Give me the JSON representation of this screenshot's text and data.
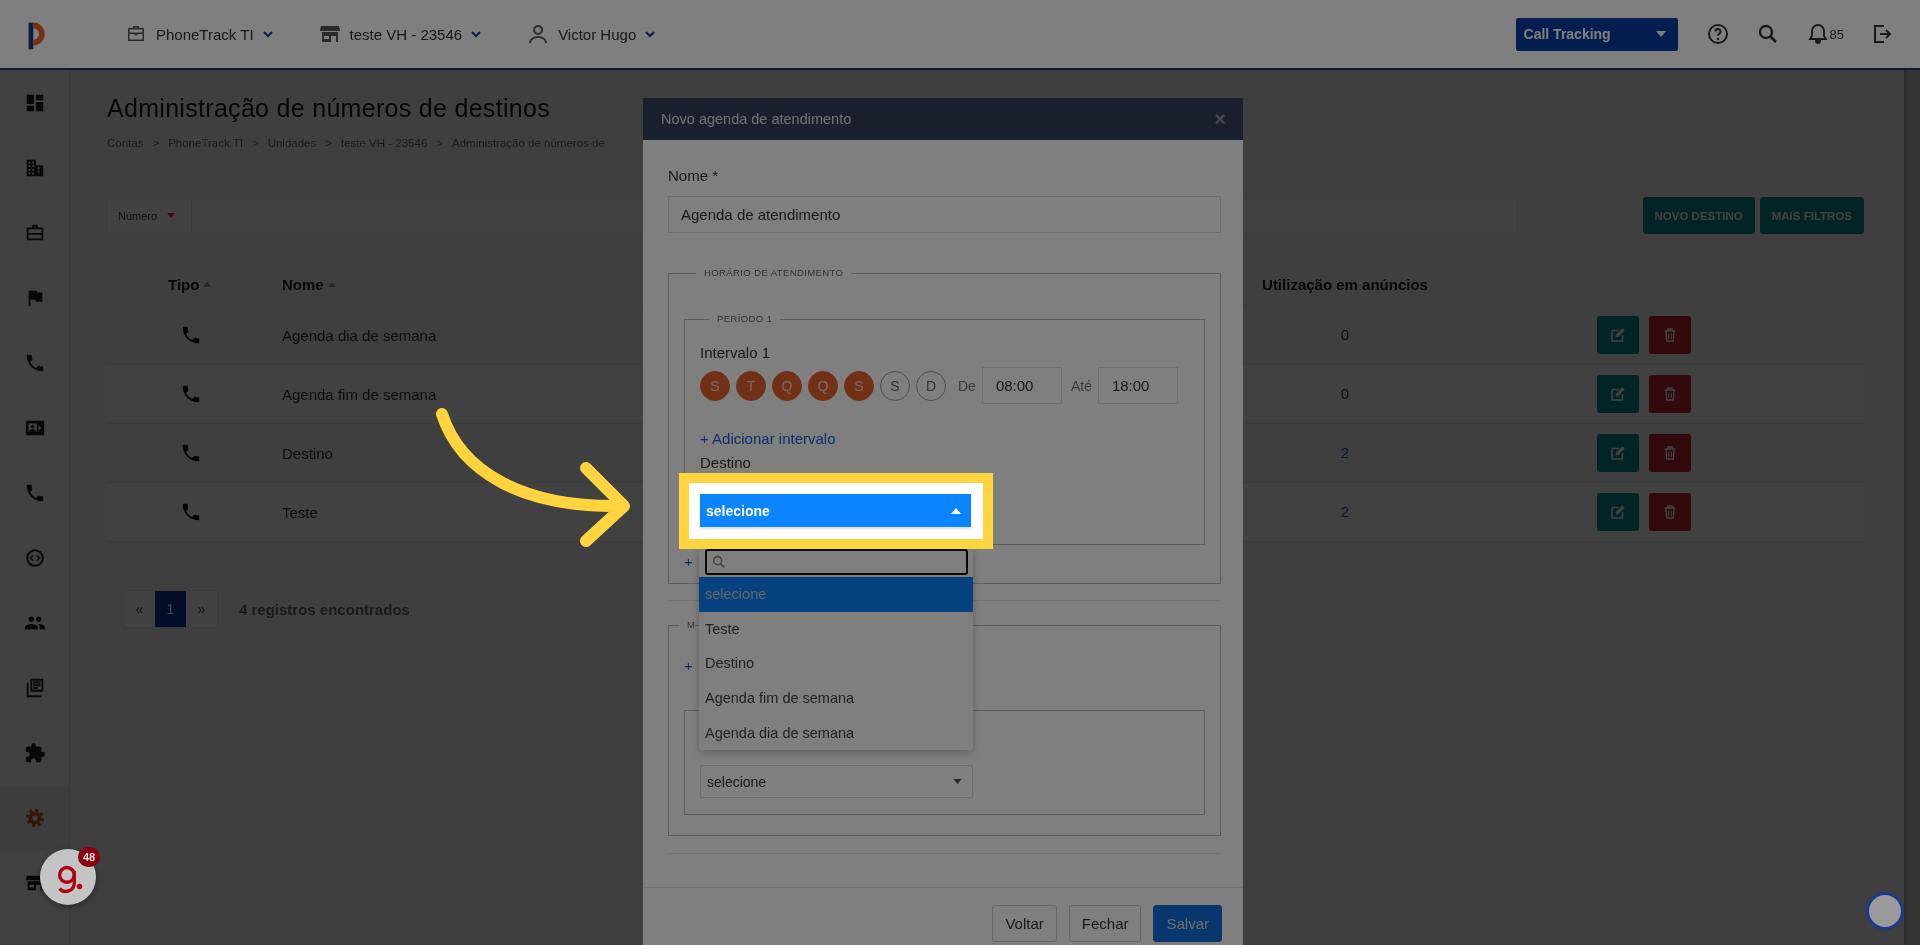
{
  "topbar": {
    "account": "PhoneTrack TI",
    "unit": "teste VH - 23546",
    "user": "Victor Hugo",
    "product": "Call Tracking",
    "notifications": "85"
  },
  "sidebar": {
    "items": [
      {
        "kind": "dashboard",
        "selected": false
      },
      {
        "kind": "building",
        "selected": false
      },
      {
        "kind": "briefcase",
        "selected": false
      },
      {
        "kind": "flag",
        "selected": false
      },
      {
        "kind": "phone",
        "selected": false
      },
      {
        "kind": "card",
        "selected": false
      },
      {
        "kind": "phone",
        "selected": false
      },
      {
        "kind": "code",
        "selected": false
      },
      {
        "kind": "people",
        "selected": false
      },
      {
        "kind": "documents",
        "selected": false
      },
      {
        "kind": "puzzle",
        "selected": false
      },
      {
        "kind": "gear",
        "selected": true
      },
      {
        "kind": "store",
        "selected": false
      }
    ]
  },
  "page": {
    "title": "Administração de números de destinos",
    "breadcrumb": [
      "Contas",
      "PhoneTrack TI",
      "Unidades",
      "teste VH - 23546",
      "Administração de números de"
    ],
    "separator": ">"
  },
  "filter": {
    "field": "Número"
  },
  "actions": [
    "NOVO DESTINO",
    "MAIS FILTROS"
  ],
  "table": {
    "columns": [
      "Tipo",
      "Nome",
      "Utilização em anúncios"
    ],
    "rows": [
      {
        "name": "Agenda dia de semana",
        "usage": "0",
        "linked": false
      },
      {
        "name": "Agenda fim de semana",
        "usage": "0",
        "linked": false
      },
      {
        "name": "Destino",
        "usage": "2",
        "linked": true
      },
      {
        "name": "Teste",
        "usage": "2",
        "linked": true
      }
    ]
  },
  "pagination": {
    "prev": "«",
    "next": "»",
    "pages": [
      {
        "label": "1",
        "selected": true
      }
    ],
    "summary": "4 registros encontrados"
  },
  "modal": {
    "title": "Novo agenda de atendimento",
    "close": "×",
    "name_label": "Nome *",
    "name_value": "Agenda de atendimento",
    "schedule_legend": "HORÁRIO DE ATENDIMENTO",
    "period_legend": "PERÍODO 1",
    "interval_label": "Intervalo 1",
    "days": [
      {
        "label": "S",
        "selected": true
      },
      {
        "label": "T",
        "selected": true
      },
      {
        "label": "Q",
        "selected": true
      },
      {
        "label": "Q",
        "selected": true
      },
      {
        "label": "S",
        "selected": true
      },
      {
        "label": "S",
        "selected": false
      },
      {
        "label": "D",
        "selected": false
      }
    ],
    "from_label": "De",
    "from": "08:00",
    "to_label": "Até",
    "to": "18:00",
    "add_interval": "+ Adicionar intervalo",
    "destination_label": "Destino",
    "destination_select": "selecione",
    "add_period": "+",
    "section2_legend": "M",
    "add_2": "+",
    "select2": "selecione",
    "buttons": [
      "Voltar",
      "Fechar",
      "Salvar"
    ]
  },
  "dropdown": {
    "options": [
      {
        "label": "selecione",
        "selected": true
      },
      {
        "label": "Teste",
        "selected": false
      },
      {
        "label": "Destino",
        "selected": false
      },
      {
        "label": "Agenda fim de semana",
        "selected": false
      },
      {
        "label": "Agenda dia de semana",
        "selected": false
      }
    ]
  },
  "chat_badge": "48"
}
